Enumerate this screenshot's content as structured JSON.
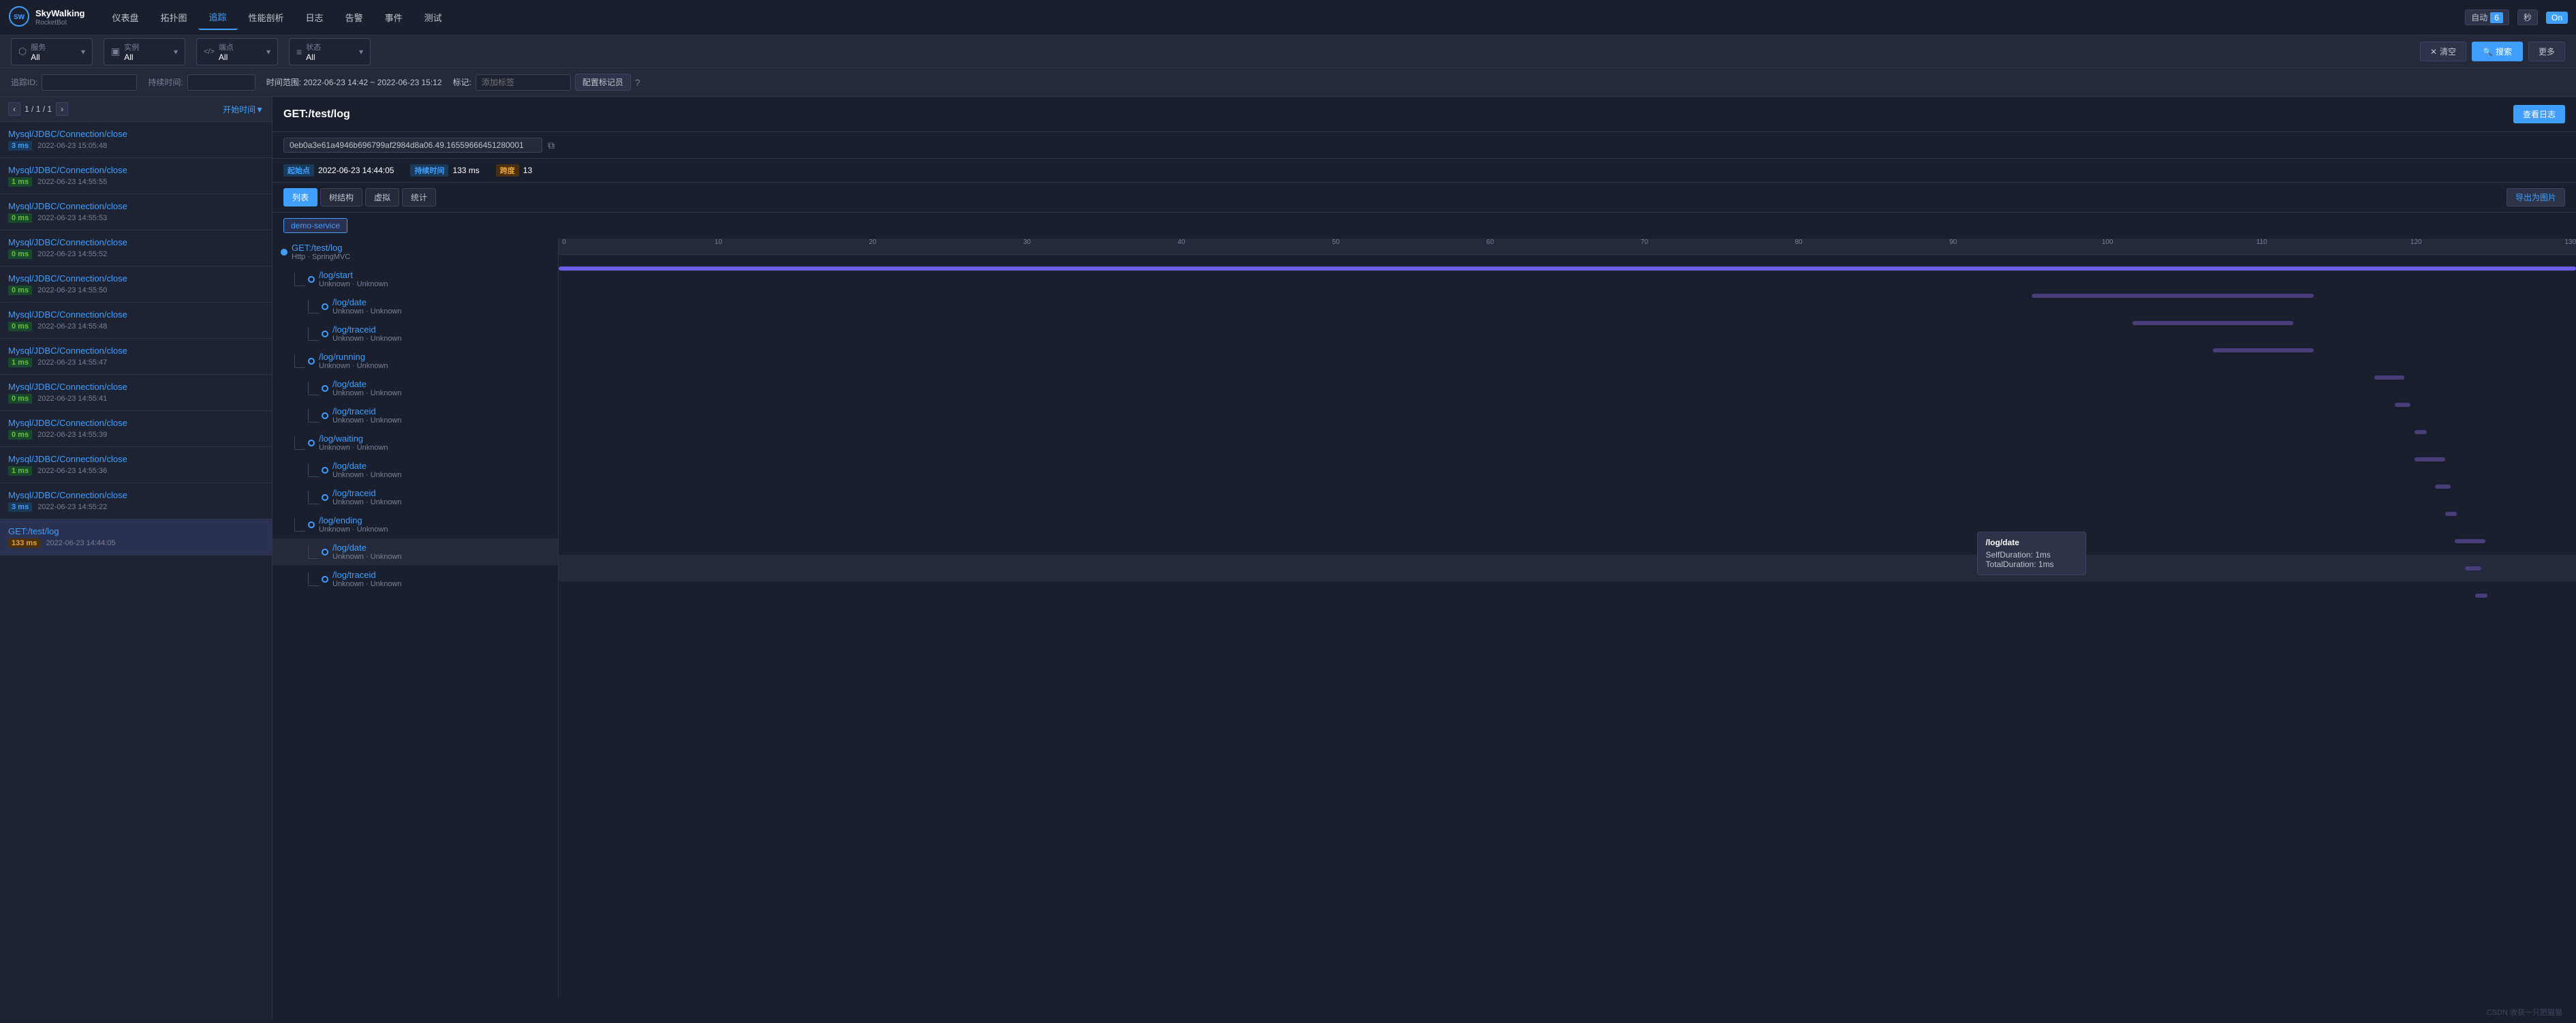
{
  "app": {
    "logo_line1": "SkyWalking",
    "logo_line2": "RocketBot"
  },
  "nav": {
    "items": [
      {
        "id": "dashboard",
        "label": "仪表盘",
        "active": false
      },
      {
        "id": "topology",
        "label": "拓扑图",
        "active": false
      },
      {
        "id": "trace",
        "label": "追踪",
        "active": true
      },
      {
        "id": "performance",
        "label": "性能剖析",
        "active": false
      },
      {
        "id": "log",
        "label": "日志",
        "active": false
      },
      {
        "id": "alert",
        "label": "告警",
        "active": false
      },
      {
        "id": "event",
        "label": "事件",
        "active": false
      },
      {
        "id": "test",
        "label": "测试",
        "active": false
      }
    ],
    "auto_label": "自动",
    "auto_value": "6",
    "timer_value": "秒",
    "on_label": "On"
  },
  "filters": {
    "service": {
      "icon": "⬡",
      "label": "服务",
      "value": "All"
    },
    "instance": {
      "icon": "▣",
      "label": "实例",
      "value": "All"
    },
    "endpoint": {
      "icon": "</>",
      "label": "端点",
      "value": "All"
    },
    "status": {
      "icon": "≡",
      "label": "状态",
      "value": "All"
    },
    "btn_clear": "清空",
    "btn_search": "搜索",
    "btn_more": "更多"
  },
  "search": {
    "trace_id_label": "追踪ID:",
    "trace_id_placeholder": "",
    "duration_label": "持续时间:",
    "duration_placeholder": "",
    "time_range": "时间范围: 2022-06-23 14:42 ~ 2022-06-23 15:12",
    "tag_label": "标记:",
    "tag_placeholder": "添加标签",
    "config_btn": "配置标记员"
  },
  "list": {
    "page_info": "1 / 1",
    "sort_label": "开始时间▼",
    "items": [
      {
        "name": "Mysql/JDBC/Connection/close",
        "ms": "3 ms",
        "ms_class": "blue",
        "time": "2022-06-23 15:05:48"
      },
      {
        "name": "Mysql/JDBC/Connection/close",
        "ms": "1 ms",
        "ms_class": "green",
        "time": "2022-06-23 14:55:55"
      },
      {
        "name": "Mysql/JDBC/Connection/close",
        "ms": "0 ms",
        "ms_class": "green",
        "time": "2022-06-23 14:55:53"
      },
      {
        "name": "Mysql/JDBC/Connection/close",
        "ms": "0 ms",
        "ms_class": "green",
        "time": "2022-06-23 14:55:52"
      },
      {
        "name": "Mysql/JDBC/Connection/close",
        "ms": "0 ms",
        "ms_class": "green",
        "time": "2022-06-23 14:55:50"
      },
      {
        "name": "Mysql/JDBC/Connection/close",
        "ms": "0 ms",
        "ms_class": "green",
        "time": "2022-06-23 14:55:48"
      },
      {
        "name": "Mysql/JDBC/Connection/close",
        "ms": "1 ms",
        "ms_class": "green",
        "time": "2022-06-23 14:55:47"
      },
      {
        "name": "Mysql/JDBC/Connection/close",
        "ms": "0 ms",
        "ms_class": "green",
        "time": "2022-06-23 14:55:41"
      },
      {
        "name": "Mysql/JDBC/Connection/close",
        "ms": "0 ms",
        "ms_class": "green",
        "time": "2022-06-23 14:55:39"
      },
      {
        "name": "Mysql/JDBC/Connection/close",
        "ms": "1 ms",
        "ms_class": "green",
        "time": "2022-06-23 14:55:36"
      },
      {
        "name": "Mysql/JDBC/Connection/close",
        "ms": "3 ms",
        "ms_class": "blue",
        "time": "2022-06-23 14:55:22"
      },
      {
        "name": "GET:/test/log",
        "ms": "133 ms",
        "ms_class": "orange",
        "time": "2022-06-23 14:44:05"
      }
    ]
  },
  "detail": {
    "title": "GET:/test/log",
    "trace_id": "0eb0a3e61a4946b696799af2984d8a06.49.16559666451280001",
    "btn_view_log": "查看日志",
    "start_point_label": "起始点",
    "start_time": "2022-06-23 14:44:05",
    "duration_label": "持续时间",
    "duration_value": "133 ms",
    "span_label": "跨度",
    "span_count": "13",
    "service_badge": "demo-service",
    "view_tabs": [
      "列表",
      "树结构",
      "虚拟",
      "统计"
    ],
    "btn_export": "导出为图片",
    "ruler_marks": [
      "0",
      "10",
      "20",
      "30",
      "40",
      "50",
      "60",
      "70",
      "80",
      "90",
      "100",
      "110",
      "120",
      "130"
    ],
    "spans": [
      {
        "name": "GET:/test/log",
        "service": "Http · SpringMVC",
        "indent": 0,
        "bar_left_pct": 0,
        "bar_width_pct": 100,
        "bar_color": "purple"
      },
      {
        "name": "/log/start",
        "service": "Unknown · Unknown",
        "indent": 1,
        "bar_left_pct": 75,
        "bar_width_pct": 15,
        "bar_color": "dark-purple"
      },
      {
        "name": "/log/date",
        "service": "Unknown · Unknown",
        "indent": 2,
        "bar_left_pct": 80,
        "bar_width_pct": 8,
        "bar_color": "dark-purple"
      },
      {
        "name": "/log/traceid",
        "service": "Unknown · Unknown",
        "indent": 2,
        "bar_left_pct": 83,
        "bar_width_pct": 5,
        "bar_color": "dark-purple"
      },
      {
        "name": "/log/running",
        "service": "Unknown · Unknown",
        "indent": 1,
        "bar_left_pct": 91,
        "bar_width_pct": 1,
        "bar_color": "dark-purple"
      },
      {
        "name": "/log/date",
        "service": "Unknown · Unknown",
        "indent": 2,
        "bar_left_pct": 92,
        "bar_width_pct": 0.5,
        "bar_color": "dark-purple"
      },
      {
        "name": "/log/traceid",
        "service": "Unknown · Unknown",
        "indent": 2,
        "bar_left_pct": 92.5,
        "bar_width_pct": 0.5,
        "bar_color": "dark-purple"
      },
      {
        "name": "/log/waiting",
        "service": "Unknown · Unknown",
        "indent": 1,
        "bar_left_pct": 93,
        "bar_width_pct": 1,
        "bar_color": "dark-purple"
      },
      {
        "name": "/log/date",
        "service": "Unknown · Unknown",
        "indent": 2,
        "bar_left_pct": 93.5,
        "bar_width_pct": 0.5,
        "bar_color": "dark-purple"
      },
      {
        "name": "/log/traceid",
        "service": "Unknown · Unknown",
        "indent": 2,
        "bar_left_pct": 94,
        "bar_width_pct": 0.5,
        "bar_color": "dark-purple"
      },
      {
        "name": "/log/ending",
        "service": "Unknown · Unknown",
        "indent": 1,
        "bar_left_pct": 94.5,
        "bar_width_pct": 1,
        "bar_color": "dark-purple"
      },
      {
        "name": "/log/date",
        "service": "Unknown · Unknown",
        "indent": 2,
        "bar_left_pct": 95,
        "bar_width_pct": 0.5,
        "bar_color": "dark-purple"
      },
      {
        "name": "/log/traceid",
        "service": "Unknown · Unknown",
        "indent": 2,
        "bar_left_pct": 95.5,
        "bar_width_pct": 0.5,
        "bar_color": "dark-purple"
      }
    ],
    "tooltip": {
      "title": "/log/date",
      "self_duration": "SelfDuration: 1ms",
      "total_duration": "TotalDuration: 1ms"
    }
  },
  "footer": {
    "text": "CSDN 收获一只肥猫猫"
  }
}
